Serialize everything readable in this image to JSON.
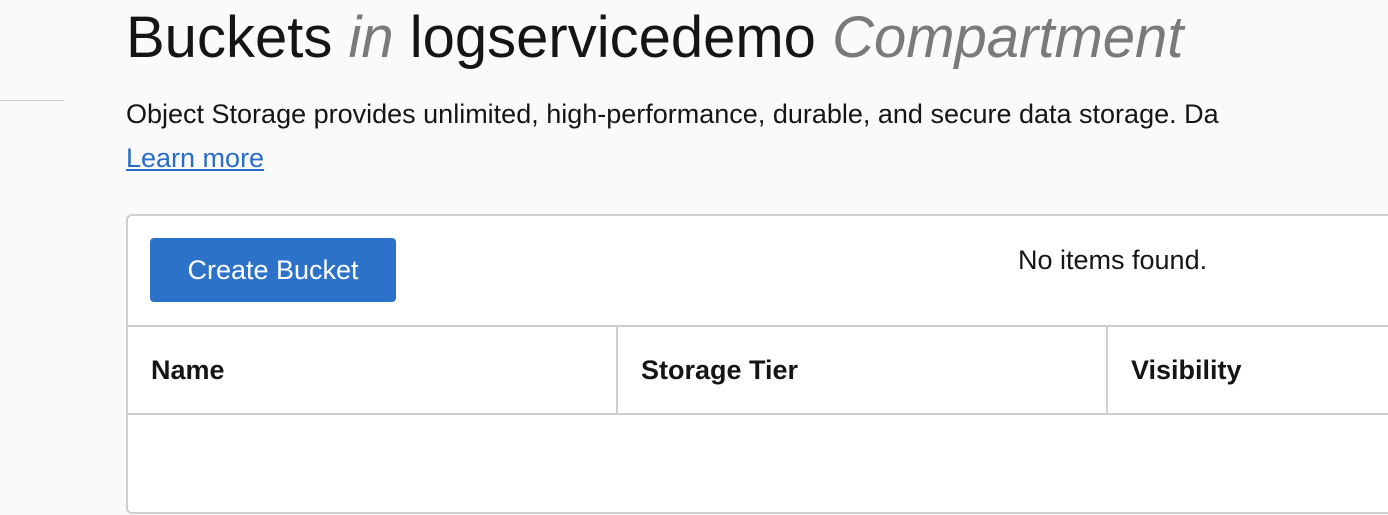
{
  "page": {
    "title_prefix": "Buckets",
    "title_in": "in",
    "title_compartment": "logservicedemo",
    "title_suffix": "Compartment",
    "description": "Object Storage provides unlimited, high-performance, durable, and secure data storage. Da",
    "learn_more": "Learn more"
  },
  "toolbar": {
    "create_bucket_label": "Create Bucket"
  },
  "table": {
    "columns": [
      "Name",
      "Storage Tier",
      "Visibility"
    ],
    "empty_message": "No items found."
  },
  "colors": {
    "primary_button": "#2d72c9",
    "link": "#2a6dc9",
    "page_background": "#fafafa",
    "muted_text": "#7a7a7a"
  }
}
